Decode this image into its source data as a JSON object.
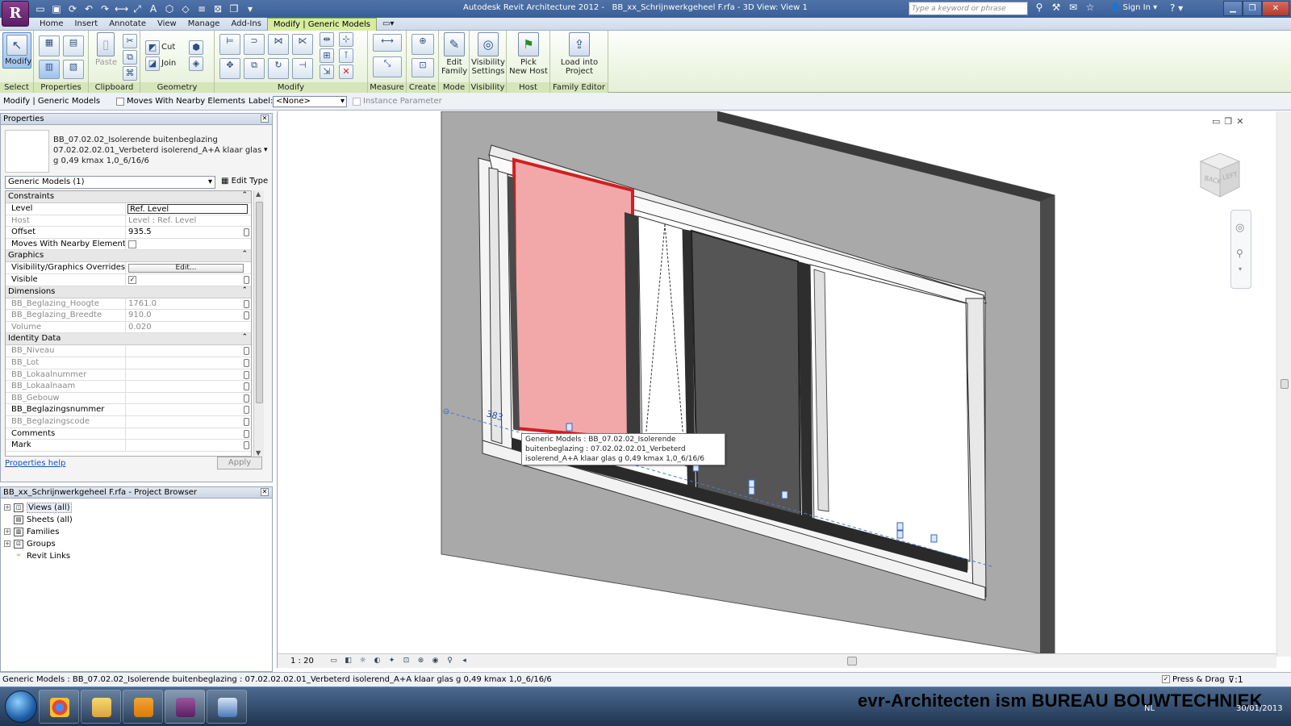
{
  "title_bar": {
    "app_title": "Autodesk Revit Architecture 2012 -",
    "doc_title": "BB_xx_Schrijnwerkgeheel F.rfa - 3D View: View 1",
    "search_placeholder": "Type a keyword or phrase",
    "sign_in": "Sign In",
    "app_button_label": "R"
  },
  "ribbon_tabs": [
    "Home",
    "Insert",
    "Annotate",
    "View",
    "Manage",
    "Add-Ins",
    "Modify | Generic Models"
  ],
  "ribbon": {
    "select": {
      "panel": "Select",
      "modify": "Modify"
    },
    "properties": {
      "panel": "Properties"
    },
    "clipboard": {
      "panel": "Clipboard",
      "paste": "Paste"
    },
    "geometry": {
      "panel": "Geometry",
      "cut": "Cut",
      "join": "Join"
    },
    "modify": {
      "panel": "Modify"
    },
    "measure": {
      "panel": "Measure"
    },
    "create": {
      "panel": "Create"
    },
    "mode": {
      "panel": "Mode",
      "edit_family_1": "Edit",
      "edit_family_2": "Family"
    },
    "visibility": {
      "panel": "Visibility",
      "vis_1": "Visibility",
      "vis_2": "Settings"
    },
    "host": {
      "panel": "Host",
      "pick_1": "Pick",
      "pick_2": "New Host"
    },
    "family_editor": {
      "panel": "Family Editor",
      "load_1": "Load into",
      "load_2": "Project"
    }
  },
  "options_bar": {
    "context": "Modify | Generic Models",
    "moves_with": "Moves With Nearby Elements",
    "label_caption": "Label:",
    "label_value": "<None>",
    "instance_param": "Instance Parameter"
  },
  "properties": {
    "title": "Properties",
    "type_name": "BB_07.02.02_Isolerende buitenbeglazing 07.02.02.02.01_Verbeterd isolerend_A+A klaar glas g 0,49 kmax 1,0_6/16/6",
    "instance_selector": "Generic Models (1)",
    "edit_type": "Edit Type",
    "groups": {
      "constraints": "Constraints",
      "graphics": "Graphics",
      "dimensions": "Dimensions",
      "identity": "Identity Data"
    },
    "rows": {
      "level": {
        "k": "Level",
        "v": "Ref. Level"
      },
      "host": {
        "k": "Host",
        "v": "Level : Ref. Level"
      },
      "offset": {
        "k": "Offset",
        "v": "935.5"
      },
      "moves": {
        "k": "Moves With Nearby Elements",
        "v": ""
      },
      "vgo": {
        "k": "Visibility/Graphics Overrides",
        "v": "Edit..."
      },
      "visible": {
        "k": "Visible",
        "v": "✓"
      },
      "hoogte": {
        "k": "BB_Beglazing_Hoogte",
        "v": "1761.0"
      },
      "breedte": {
        "k": "BB_Beglazing_Breedte",
        "v": "910.0"
      },
      "volume": {
        "k": "Volume",
        "v": "0.020"
      },
      "niveau": {
        "k": "BB_Niveau",
        "v": ""
      },
      "lot": {
        "k": "BB_Lot",
        "v": ""
      },
      "lokaalnummer": {
        "k": "BB_Lokaalnummer",
        "v": ""
      },
      "lokaalnaam": {
        "k": "BB_Lokaalnaam",
        "v": ""
      },
      "gebouw": {
        "k": "BB_Gebouw",
        "v": ""
      },
      "beglazingsnummer": {
        "k": "BB_Beglazingsnummer",
        "v": ""
      },
      "beglazingscode": {
        "k": "BB_Beglazingscode",
        "v": ""
      },
      "comments": {
        "k": "Comments",
        "v": ""
      },
      "mark": {
        "k": "Mark",
        "v": ""
      }
    },
    "help_link": "Properties help",
    "apply": "Apply"
  },
  "project_browser": {
    "title": "BB_xx_Schrijnwerkgeheel F.rfa - Project Browser",
    "nodes": [
      "Views (all)",
      "Sheets (all)",
      "Families",
      "Groups",
      "Revit Links"
    ]
  },
  "viewport": {
    "tooltip": "Generic Models : BB_07.02.02_Isolerende buitenbeglazing : 07.02.02.02.01_Verbeterd isolerend_A+A klaar glas g 0,49 kmax 1,0_6/16/6",
    "dimension_text": "383",
    "scale": "1 : 20",
    "viewcube_back": "BACK",
    "viewcube_left": "LEFT"
  },
  "status_bar": {
    "text": "Generic Models : BB_07.02.02_Isolerende buitenbeglazing : 07.02.02.02.01_Verbeterd isolerend_A+A klaar glas g 0,49 kmax 1,0_6/16/6",
    "press_drag": "Press & Drag",
    "filter_count": ":1"
  },
  "taskbar": {
    "watermark": "evr-Architecten ism BUREAU BOUWTECHNIEK",
    "lang": "NL",
    "date": "30/01/2013"
  },
  "colors": {
    "ribbon_green": "#d7ec9f",
    "selection_red": "#e03030",
    "wall_gray": "#a9a9a9"
  }
}
